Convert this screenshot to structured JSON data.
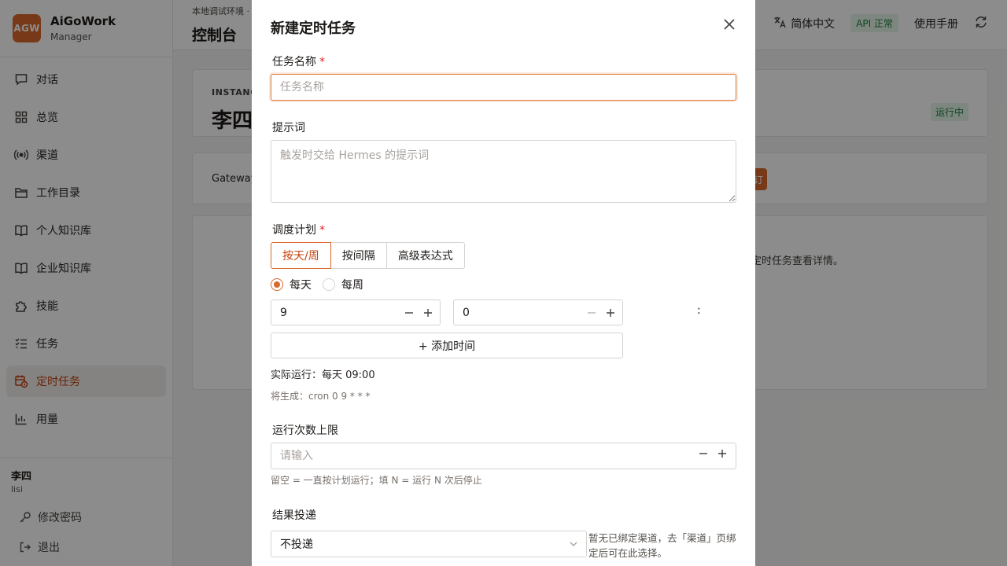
{
  "app": {
    "logo_text": "AGW",
    "name": "AiGoWork",
    "subtitle": "Manager"
  },
  "sidebar": {
    "items": [
      {
        "label": "对话",
        "icon": "chat-icon"
      },
      {
        "label": "总览",
        "icon": "grid-icon"
      },
      {
        "label": "渠道",
        "icon": "broadcast-icon"
      },
      {
        "label": "工作目录",
        "icon": "folder-icon"
      },
      {
        "label": "个人知识库",
        "icon": "book-icon"
      },
      {
        "label": "企业知识库",
        "icon": "book-icon"
      },
      {
        "label": "技能",
        "icon": "puzzle-icon"
      },
      {
        "label": "任务",
        "icon": "checklist-icon"
      },
      {
        "label": "定时任务",
        "icon": "clock-calendar-icon",
        "active": true
      },
      {
        "label": "用量",
        "icon": "bar-chart-icon"
      }
    ],
    "user": {
      "name": "李四",
      "id": "lisi"
    },
    "actions": [
      {
        "label": "修改密码",
        "icon": "key-icon"
      },
      {
        "label": "退出",
        "icon": "logout-icon"
      }
    ]
  },
  "header": {
    "breadcrumb": "本地调试环境 ·",
    "title": "控制台",
    "language": "简体中文",
    "api_status": "API 正常",
    "manual": "使用手册"
  },
  "main": {
    "instance_label": "INSTANC",
    "instance_name": "李四",
    "status": "运行中",
    "gateway_label": "Gateway",
    "orange_button_fragment": "订",
    "hint_fragment": "定时任务查看详情。"
  },
  "modal": {
    "title": "新建定时任务",
    "task_name": {
      "label": "任务名称",
      "required": "*",
      "placeholder": "任务名称",
      "value": ""
    },
    "prompt": {
      "label": "提示词",
      "placeholder": "触发时交给 Hermes 的提示词"
    },
    "schedule": {
      "label": "调度计划",
      "required": "*",
      "tabs": [
        "按天/周",
        "按间隔",
        "高级表达式"
      ],
      "active_tab": "按天/周",
      "frequency_options": [
        "每天",
        "每周"
      ],
      "selected_frequency": "每天",
      "hour": "9",
      "minute": "0",
      "colon": ":",
      "add_time": "+ 添加时间",
      "actual_run": "实际运行：每天 09:00",
      "cron_preview": "将生成：cron 0 9 * * *"
    },
    "max_runs": {
      "label": "运行次数上限",
      "placeholder": "请输入",
      "help": "留空 = 一直按计划运行；填 N = 运行 N 次后停止"
    },
    "delivery": {
      "label": "结果投递",
      "selected": "不投递",
      "note": "暂无已绑定渠道，去「渠道」页绑定后可在此选择。"
    }
  }
}
